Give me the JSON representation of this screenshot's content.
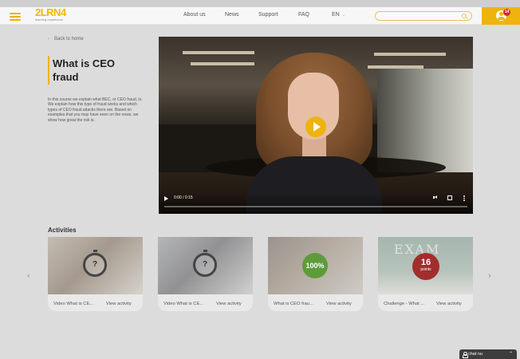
{
  "header": {
    "logo_main": "2LRN4",
    "logo_sub": "learning experience",
    "nav": [
      "About us",
      "News",
      "Support",
      "FAQ"
    ],
    "language": "EN",
    "search_placeholder": "",
    "notification_count": "14"
  },
  "page": {
    "back_label": "Back to home",
    "title": "What is CEO fraud",
    "description": "In this course we explain what BEC, or CEO fraud, is. We explain how this type of fraud works and which types of CEO fraud attacks there are. Based on examples that you may have seen on the news, we show how great the risk is."
  },
  "video": {
    "time": "0:00 / 0:15",
    "progress": 0.0
  },
  "activities": {
    "title": "Activities",
    "items": [
      {
        "label": "Video What is CE...",
        "link": "View activity",
        "badge": "?"
      },
      {
        "label": "Video What is CE...",
        "link": "View activity",
        "badge": "?"
      },
      {
        "label": "What is CEO frau...",
        "link": "View activity",
        "badge": "100%"
      },
      {
        "label": "Challenge - What ...",
        "link": "View activity",
        "badge_num": "16",
        "badge_lbl": "points",
        "board_text": "EXAM"
      }
    ]
  },
  "chat": {
    "label": "chat nu"
  },
  "colors": {
    "accent": "#efb30e",
    "badge_red": "#d6262c",
    "success": "#5e9b3c",
    "points": "#a22d2d"
  }
}
